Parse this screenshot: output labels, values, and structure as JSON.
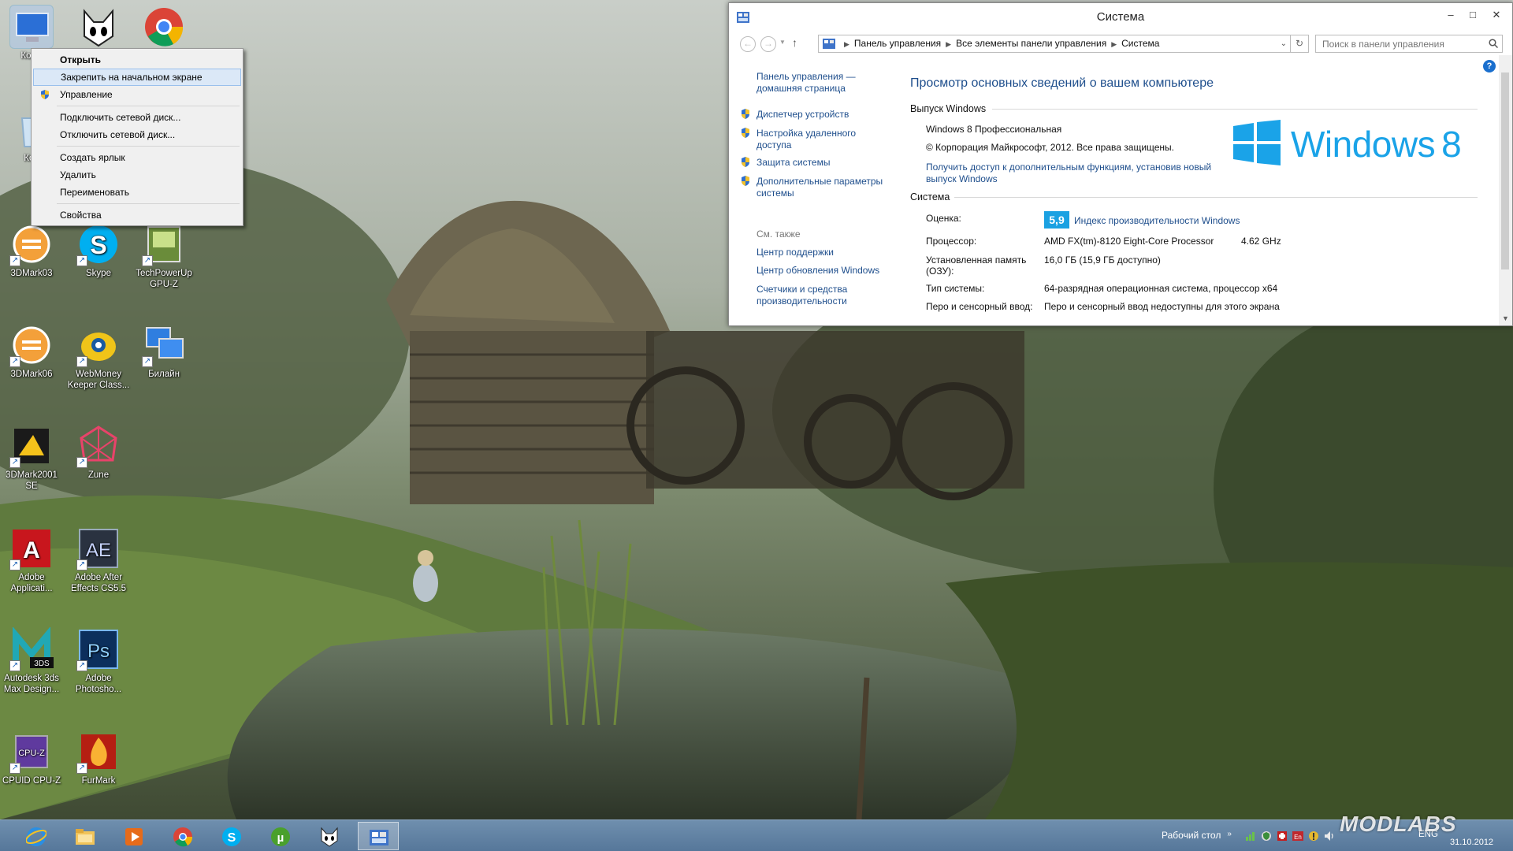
{
  "desktop": {
    "icons": [
      {
        "label": "Комп",
        "kind": "computer"
      },
      {
        "label": "",
        "kind": "foobar"
      },
      {
        "label": "",
        "kind": "chrome"
      },
      {
        "label": "Кор",
        "kind": "recycle"
      },
      {
        "label": "3DMark03",
        "kind": "3dmark"
      },
      {
        "label": "Skype",
        "kind": "skype"
      },
      {
        "label": "TechPowerUp GPU-Z",
        "kind": "gpuz"
      },
      {
        "label": "3DMark06",
        "kind": "3dmark"
      },
      {
        "label": "WebMoney Keeper Class...",
        "kind": "webmoney"
      },
      {
        "label": "Билайн",
        "kind": "network"
      },
      {
        "label": "3DMark2001 SE",
        "kind": "3dmark2001"
      },
      {
        "label": "Zune",
        "kind": "zune"
      },
      {
        "label": "Adobe Applicati...",
        "kind": "adobe"
      },
      {
        "label": "Adobe After Effects CS5.5",
        "kind": "ae"
      },
      {
        "label": "Autodesk 3ds Max Design...",
        "kind": "max"
      },
      {
        "label": "Adobe Photosho...",
        "kind": "ps"
      },
      {
        "label": "CPUID CPU-Z",
        "kind": "cpuz"
      },
      {
        "label": "FurMark",
        "kind": "furmark"
      }
    ]
  },
  "context_menu": {
    "items": [
      {
        "label": "Открыть",
        "bold": true
      },
      {
        "label": "Закрепить на начальном экране",
        "hover": true
      },
      {
        "label": "Управление",
        "shield": true
      },
      {
        "sep": true
      },
      {
        "label": "Подключить сетевой диск..."
      },
      {
        "label": "Отключить сетевой диск..."
      },
      {
        "sep": true
      },
      {
        "label": "Создать ярлык"
      },
      {
        "label": "Удалить"
      },
      {
        "label": "Переименовать"
      },
      {
        "sep": true
      },
      {
        "label": "Свойства"
      }
    ]
  },
  "window": {
    "title": "Система",
    "address": {
      "crumbs": [
        "Панель управления",
        "Все элементы панели управления",
        "Система"
      ]
    },
    "search_placeholder": "Поиск в панели управления",
    "left_pane": {
      "home": "Панель управления — домашняя страница",
      "links": [
        "Диспетчер устройств",
        "Настройка удаленного доступа",
        "Защита системы",
        "Дополнительные параметры системы"
      ],
      "see_also_title": "См. также",
      "see_also": [
        "Центр поддержки",
        "Центр обновления Windows",
        "Счетчики и средства производительности"
      ]
    },
    "main": {
      "heading": "Просмотр основных сведений о вашем компьютере",
      "edition_section": "Выпуск Windows",
      "edition": "Windows 8 Профессиональная",
      "copyright": "© Корпорация Майкрософт, 2012. Все права защищены.",
      "upgrade_link": "Получить доступ к дополнительным функциям, установив новый выпуск Windows",
      "system_section": "Система",
      "rating_label": "Оценка:",
      "rating_value": "5,9",
      "rating_link": "Индекс производительности Windows",
      "cpu_label": "Процессор:",
      "cpu_value": "AMD FX(tm)-8120 Eight-Core Processor",
      "cpu_freq": "4.62 GHz",
      "ram_label": "Установленная память (ОЗУ):",
      "ram_value": "16,0 ГБ (15,9 ГБ доступно)",
      "type_label": "Тип системы:",
      "type_value": "64-разрядная операционная система, процессор x64",
      "pen_label": "Перо и сенсорный ввод:",
      "pen_value": "Перо и сенсорный ввод недоступны для этого экрана",
      "logo_text": "Windows",
      "logo_ver": "8"
    }
  },
  "taskbar": {
    "apps": [
      "ie-icon",
      "explorer-icon",
      "media-icon",
      "chrome-icon",
      "skype-icon",
      "utorrent-icon",
      "foobar-icon",
      "control-panel-icon"
    ],
    "desktop_toolbar": "Рабочий стол",
    "lang": "ENG",
    "date": "31.10.2012"
  },
  "watermark": "MODLABS"
}
